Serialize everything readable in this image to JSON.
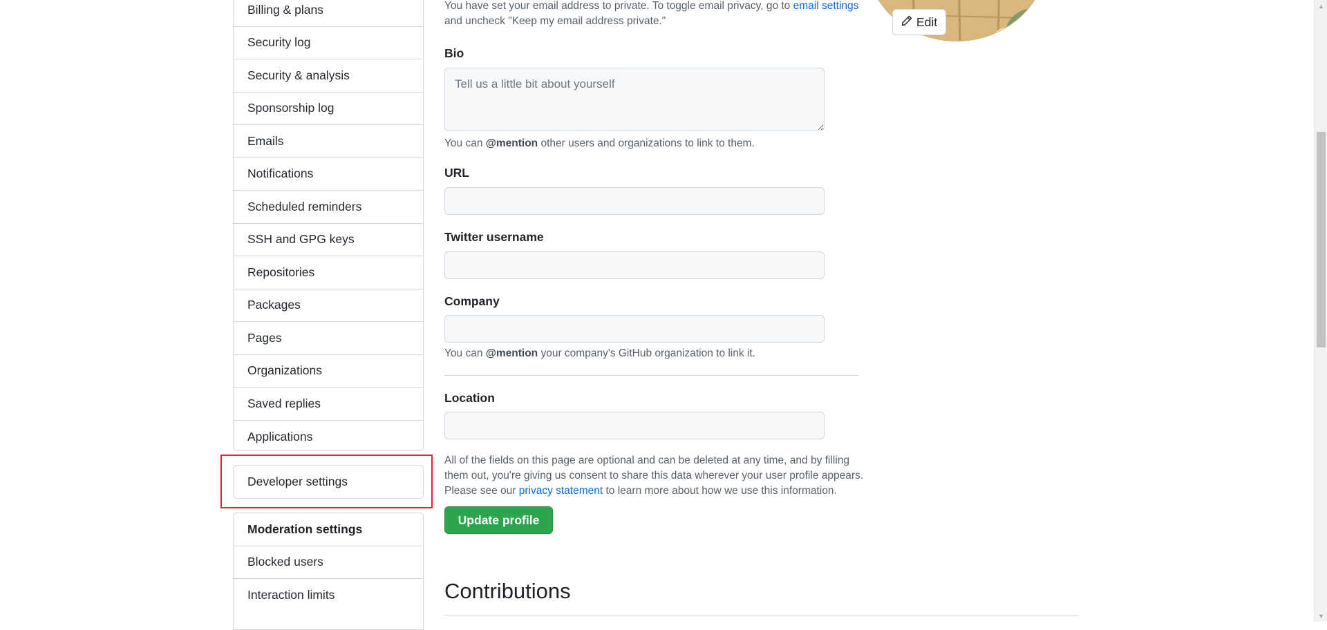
{
  "sidebar": {
    "items": [
      {
        "label": "Billing & plans"
      },
      {
        "label": "Security log"
      },
      {
        "label": "Security & analysis"
      },
      {
        "label": "Sponsorship log"
      },
      {
        "label": "Emails"
      },
      {
        "label": "Notifications"
      },
      {
        "label": "Scheduled reminders"
      },
      {
        "label": "SSH and GPG keys"
      },
      {
        "label": "Repositories"
      },
      {
        "label": "Packages"
      },
      {
        "label": "Pages"
      },
      {
        "label": "Organizations"
      },
      {
        "label": "Saved replies"
      },
      {
        "label": "Applications"
      }
    ],
    "developer": {
      "label": "Developer settings"
    },
    "moderation": {
      "header": "Moderation settings",
      "items": [
        {
          "label": "Blocked users"
        },
        {
          "label": "Interaction limits"
        }
      ]
    }
  },
  "email_note": {
    "line1_prefix": "You have set your email address to private. To toggle email privacy, go to ",
    "link": "email settings",
    "line2": "and uncheck \"Keep my email address private.\""
  },
  "bio": {
    "label": "Bio",
    "placeholder": "Tell us a little bit about yourself",
    "note_prefix": "You can ",
    "note_mention": "@mention",
    "note_suffix": " other users and organizations to link to them."
  },
  "url": {
    "label": "URL",
    "value": ""
  },
  "twitter": {
    "label": "Twitter username",
    "value": ""
  },
  "company": {
    "label": "Company",
    "value": "",
    "note_prefix": "You can ",
    "note_mention": "@mention",
    "note_suffix": " your company's GitHub organization to link it."
  },
  "location": {
    "label": "Location",
    "value": ""
  },
  "disclaimer": {
    "line1": "All of the fields on this page are optional and can be deleted at any time, and by filling",
    "line2": "them out, you're giving us consent to share this data wherever your user profile appears.",
    "line3_prefix": "Please see our ",
    "line3_link": "privacy statement",
    "line3_suffix": " to learn more about how we use this information."
  },
  "update_button": {
    "label": "Update profile"
  },
  "contributions_heading": "Contributions",
  "avatar": {
    "edit_label": "Edit",
    "edit_icon": "pencil-icon"
  },
  "colors": {
    "accent_link": "#0969da",
    "primary_button": "#2da44e",
    "highlight": "#e5212b",
    "border": "#d0d7de"
  }
}
